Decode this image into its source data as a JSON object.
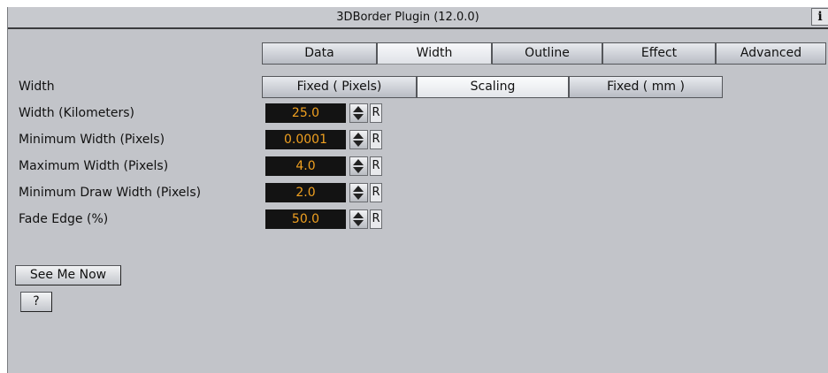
{
  "window": {
    "title": "3DBorder Plugin (12.0.0)",
    "info_label": "i"
  },
  "tabs": [
    {
      "label": "Data",
      "active": false
    },
    {
      "label": "Width",
      "active": true
    },
    {
      "label": "Outline",
      "active": false
    },
    {
      "label": "Effect",
      "active": false
    },
    {
      "label": "Advanced",
      "active": false
    }
  ],
  "width_mode": {
    "label": "Width",
    "options": [
      "Fixed ( Pixels)",
      "Scaling",
      "Fixed ( mm )"
    ],
    "selected": "Scaling"
  },
  "fields": [
    {
      "label": "Width (Kilometers)",
      "value": "25.0",
      "reset": "R"
    },
    {
      "label": "Minimum Width (Pixels)",
      "value": "0.0001",
      "reset": "R"
    },
    {
      "label": "Maximum Width (Pixels)",
      "value": "4.0",
      "reset": "R"
    },
    {
      "label": "Minimum Draw Width (Pixels)",
      "value": "2.0",
      "reset": "R"
    },
    {
      "label": "Fade Edge (%)",
      "value": "50.0",
      "reset": "R"
    }
  ],
  "buttons": {
    "see_me_now": "See Me Now",
    "help": "?"
  },
  "icons": {
    "spin": "spinner-arrows-icon",
    "info": "info-icon"
  },
  "colors": {
    "panel_bg": "#c2c4c9",
    "field_bg": "#131313",
    "field_text": "#f0a020"
  }
}
